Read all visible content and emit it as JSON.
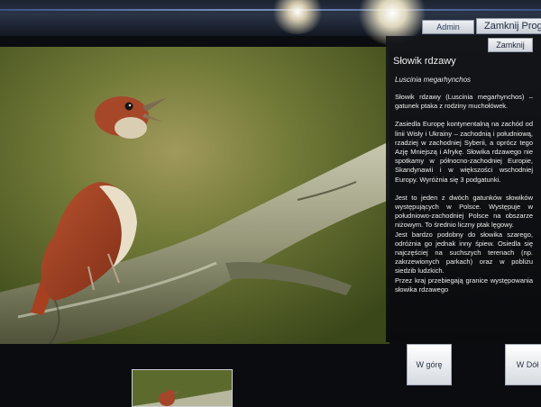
{
  "top_bar": {
    "admin_label": "Admin",
    "close_app_label": "Zamknij Progra"
  },
  "panel": {
    "close_label": "Zamknij",
    "title": "Słowik rdzawy",
    "latin_name": "Luscinia megarhynchos",
    "paragraphs": [
      "Słowik rdzawy (Luscinia megarhynchos) – gatunek ptaka z rodziny muchołówek.",
      "Zasiedla Europę kontynentalną na zachód od linii Wisły i Ukrainy – zachodnią i południową, rzadziej w zachodniej Syberii, a oprócz tego Azję Mniejszą i Afrykę. Słowika rdzawego nie spotkamy w północno-zachodniej Europie, Skandynawii i w większości wschodniej Europy. Wyróżnia się 3 podgatunki.",
      "Jest to jeden z dwóch gatunków słowików występujących w Polsce. Występuje w południowo-zachodniej Polsce na obszarze niżowym. To średnio liczny ptak lęgowy.",
      "Jest bardzo podobny do słowika szarego, odróżnia go jednak inny śpiew. Osiedla się najczęściej na suchszych terenach (np. zakrzewionych parkach) oraz w pobliżu siedzib ludzkich.",
      "Przez kraj przebiegają granice występowania słowika rdzawego"
    ]
  },
  "nav": {
    "up_label": "W górę",
    "down_label": "W Dół"
  },
  "images": {
    "main_photo_icon": "bird-on-branch-photo",
    "thumbnail_icon": "bird-thumbnail"
  },
  "colors": {
    "panel_bg": "#121316",
    "bird_rust": "#b44a2c",
    "background_green": "#5f6b2c"
  }
}
